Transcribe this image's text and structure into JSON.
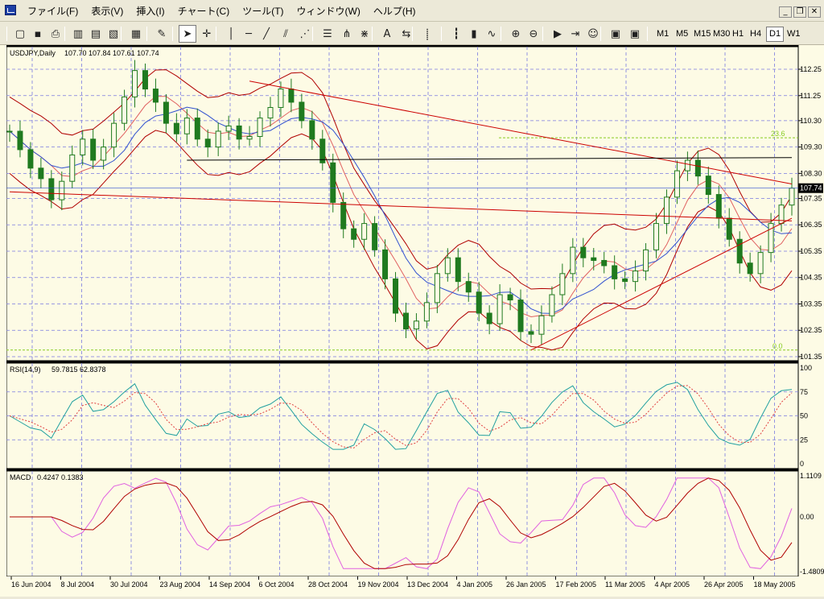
{
  "menu": {
    "items": [
      "ファイル(F)",
      "表示(V)",
      "挿入(I)",
      "チャート(C)",
      "ツール(T)",
      "ウィンドウ(W)",
      "ヘルプ(H)"
    ]
  },
  "window_controls": {
    "minimize": "_",
    "restore": "❐",
    "close": "✕"
  },
  "toolbar": {
    "timeframes": [
      "M1",
      "M5",
      "M15",
      "M30",
      "H1",
      "H4",
      "D1",
      "W1"
    ],
    "active_timeframe": "D1",
    "icons": [
      "new-chart",
      "save",
      "print",
      "open",
      "folder",
      "properties",
      "template",
      "pencil",
      "cursor",
      "crosshair",
      "vertical-line",
      "horizontal-line",
      "trendline",
      "channel",
      "gann-fan",
      "fibonacci-grid",
      "andrews-pitchfork",
      "gann-grid",
      "text",
      "arrow-label",
      "period-separator",
      "bar-chart",
      "candlestick",
      "line-chart",
      "zoom-in",
      "zoom-out",
      "auto-scroll",
      "chart-shift",
      "expert",
      "indicators",
      "scripts"
    ]
  },
  "colors": {
    "background": "#fdfbe5",
    "grid": "#7a7ae0",
    "candles": "#1f7a1f",
    "bollinger": "#b00000",
    "ma_fast": "#e06060",
    "ma_slow": "#3050d0",
    "trendline": "#cc0000",
    "support": "#000000",
    "fib": "#88cc22",
    "rsi_main": "#20a0a0",
    "rsi_signal": "#e04040",
    "macd_main": "#b00000",
    "macd_signal": "#e060e0"
  },
  "chart_data": [
    {
      "type": "candlestick",
      "symbol_label": "USDJPY,Daily",
      "ohlc_label": "107.70 107.84 107.61 107.74",
      "current_price_label": "107.74",
      "y_ticks": [
        "112.25",
        "111.25",
        "110.30",
        "109.30",
        "108.30",
        "107.35",
        "106.35",
        "105.35",
        "104.35",
        "103.35",
        "102.35",
        "101.35"
      ],
      "ylim": [
        101.35,
        112.25
      ],
      "x_ticks": [
        "16 Jun 2004",
        "8 Jul 2004",
        "30 Jul 2004",
        "23 Aug 2004",
        "14 Sep 2004",
        "6 Oct 2004",
        "28 Oct 2004",
        "19 Nov 2004",
        "13 Dec 2004",
        "4 Jan 2005",
        "26 Jan 2005",
        "17 Feb 2005",
        "11 Mar 2005",
        "4 Apr 2005",
        "26 Apr 2005",
        "18 May 2005"
      ],
      "fib_labels": [
        "23.6",
        "0.0"
      ],
      "closes": [
        109.9,
        109.2,
        108.5,
        108.1,
        107.3,
        108.0,
        109.0,
        109.6,
        108.8,
        109.3,
        110.2,
        111.2,
        112.2,
        111.5,
        111.0,
        110.2,
        109.8,
        110.4,
        109.6,
        109.3,
        109.9,
        110.1,
        109.6,
        109.7,
        110.4,
        110.8,
        111.5,
        111.0,
        110.3,
        109.6,
        108.7,
        107.2,
        106.2,
        105.8,
        106.4,
        105.4,
        104.3,
        103.0,
        102.4,
        102.7,
        103.4,
        104.5,
        105.1,
        104.2,
        103.8,
        103.0,
        102.6,
        103.7,
        103.5,
        102.3,
        102.2,
        102.9,
        103.7,
        104.5,
        105.5,
        105.1,
        105.0,
        104.8,
        104.3,
        104.2,
        104.6,
        105.4,
        106.4,
        107.4,
        108.4,
        108.8,
        108.2,
        107.5,
        106.6,
        105.8,
        104.9,
        104.5,
        105.3,
        106.4,
        107.1,
        107.74
      ],
      "rsi": {
        "label": "RSI(14,9)",
        "values_label": "59.7815 62.8378",
        "y_ticks": [
          "100",
          "75",
          "50",
          "25",
          "0"
        ],
        "ylim": [
          0,
          100
        ]
      },
      "macd": {
        "label": "MACD",
        "values_label": "0.4247 0.1383",
        "y_ticks": [
          "1.1109",
          "0.00",
          "-1.4809"
        ],
        "ylim": [
          -1.4809,
          1.1109
        ]
      }
    }
  ]
}
